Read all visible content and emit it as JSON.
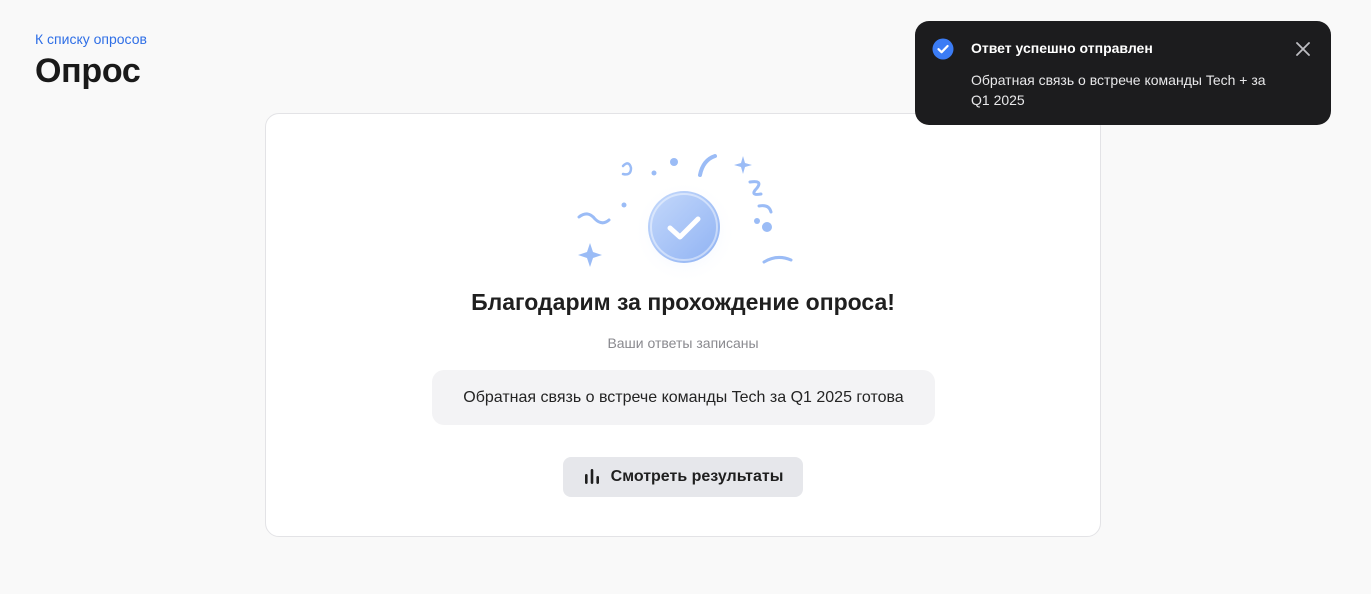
{
  "header": {
    "back_link": "К списку опросов",
    "title": "Опрос"
  },
  "card": {
    "heading": "Благодарим за прохождение опроса!",
    "subtitle": "Ваши ответы записаны",
    "info_text": "Обратная связь о встрече команды Tech за Q1 2025 готова",
    "results_button_label": "Смотреть результаты",
    "illustration_icon": "success-check-badge-icon",
    "button_icon": "bar-chart-icon"
  },
  "toast": {
    "title": "Ответ успешно отправлен",
    "message": "Обратная связь о встрече команды Tech + за Q1 2025",
    "status_icon": "check-circle-icon",
    "close_icon": "close-icon"
  },
  "colors": {
    "accent": "#2f6fe6",
    "toast_background": "#1c1c1e",
    "toast_check": "#3b7cf5",
    "badge": "#9bbcf6"
  }
}
